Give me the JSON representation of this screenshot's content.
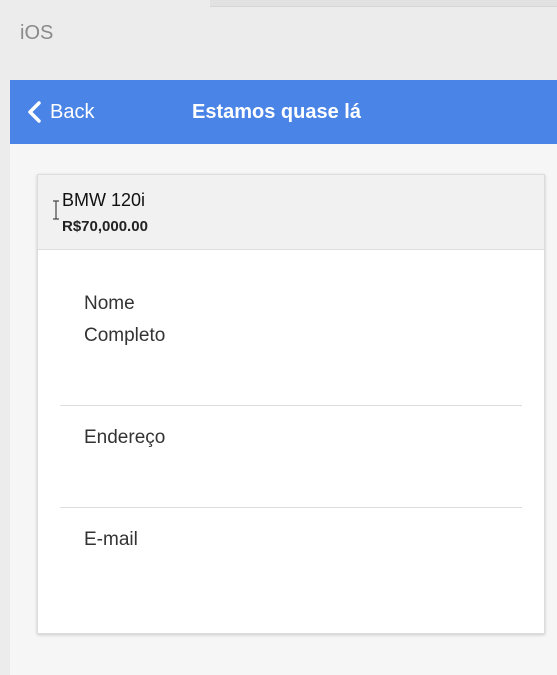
{
  "platform_label": "iOS",
  "navbar": {
    "back_label": "Back",
    "title": "Estamos quase lá",
    "color": "#4a84e6"
  },
  "product": {
    "name": "BMW 120i",
    "price": "R$70,000.00"
  },
  "form": {
    "fields": [
      {
        "label": "Nome Completo",
        "value": ""
      },
      {
        "label": "Endereço",
        "value": ""
      },
      {
        "label": "E-mail",
        "value": ""
      }
    ]
  },
  "icons": {
    "back": "chevron-left-icon",
    "cursor": "text-cursor-icon"
  }
}
